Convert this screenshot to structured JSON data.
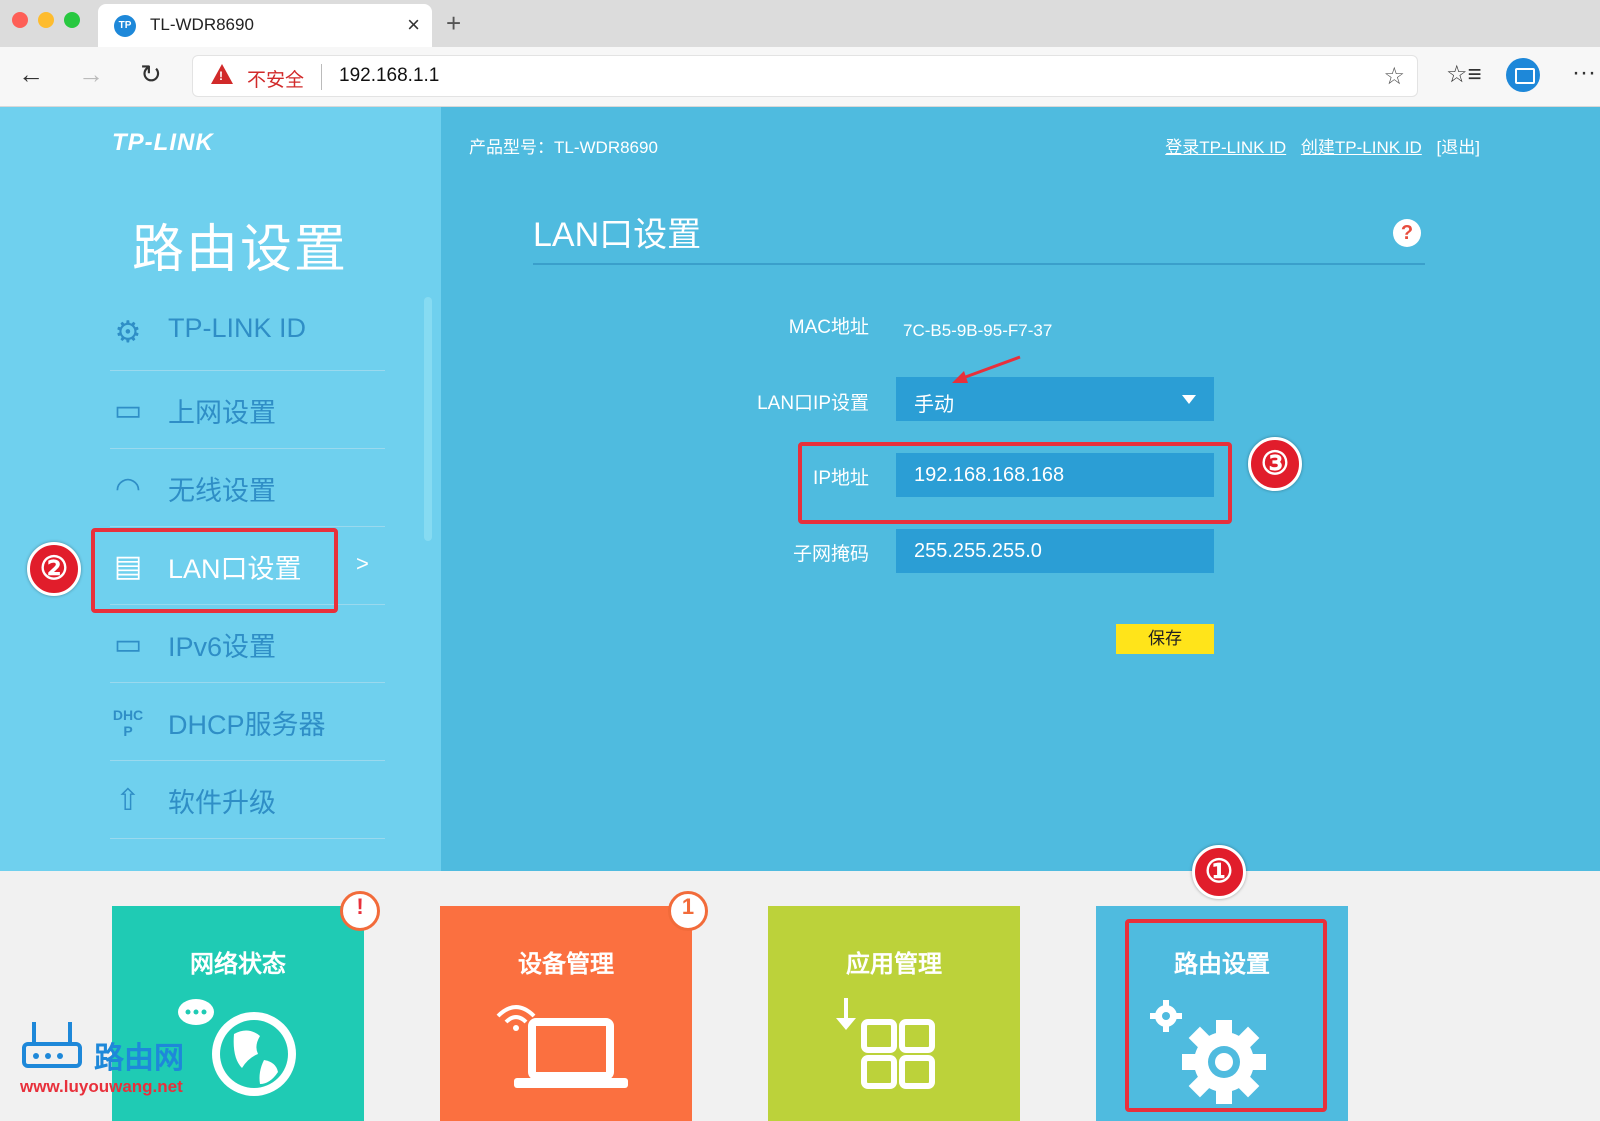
{
  "browser": {
    "tab_title": "TL-WDR8690",
    "tab_favicon": "TP",
    "tab_close": "×",
    "new_tab": "+",
    "back_icon": "←",
    "forward_icon": "→",
    "reload_icon": "↻",
    "insecure_label": "不安全",
    "url": "192.168.1.1",
    "star_icon": "☆",
    "favorites_icon": "☆≡",
    "more_icon": "···"
  },
  "router": {
    "logo": "TP-LINK",
    "model_line": "产品型号：TL-WDR8690",
    "links": {
      "login": "登录TP-LINK ID",
      "create": "创建TP-LINK ID",
      "logout": "[退出]"
    },
    "section_title": "路由设置",
    "menu": [
      {
        "label": "TP-LINK ID",
        "icon": "gear-icon",
        "glyph": "⚙"
      },
      {
        "label": "上网设置",
        "icon": "laptop-icon",
        "glyph": "▭"
      },
      {
        "label": "无线设置",
        "icon": "wifi-icon",
        "glyph": "◠"
      },
      {
        "label": "LAN口设置",
        "icon": "lan-port-icon",
        "glyph": "▤",
        "active": true,
        "arrow": ">"
      },
      {
        "label": "IPv6设置",
        "icon": "laptop-icon",
        "glyph": "▭"
      },
      {
        "label": "DHCP服务器",
        "icon": "dhcp-icon",
        "glyph": "DHCP"
      },
      {
        "label": "软件升级",
        "icon": "upload-icon",
        "glyph": "⇧"
      }
    ],
    "page_title": "LAN口设置",
    "help_icon": "?",
    "form": {
      "mac_label": "MAC地址",
      "mac_value": "7C-B5-9B-95-F7-37",
      "lan_ip_mode_label": "LAN口IP设置",
      "lan_ip_mode_value": "手动",
      "ip_label": "IP地址",
      "ip_value": "192.168.168.168",
      "mask_label": "子网掩码",
      "mask_value": "255.255.255.0",
      "save_label": "保存"
    },
    "tiles": [
      {
        "title": "网络状态",
        "color": "#1fcbb4",
        "badge": "!"
      },
      {
        "title": "设备管理",
        "color": "#fb7040",
        "badge": "1"
      },
      {
        "title": "应用管理",
        "color": "#bcd23a",
        "badge": ""
      },
      {
        "title": "路由设置",
        "color": "#4fbbdf",
        "badge": ""
      }
    ]
  },
  "annotations": {
    "callout_1": "①",
    "callout_2": "②",
    "callout_3": "③"
  },
  "watermark": {
    "brand": "路由网",
    "url": "www.luyouwang.net"
  },
  "colors": {
    "sidebar": "#6fd0ee",
    "content": "#4fbbdf",
    "field": "#2b9ed5",
    "save": "#ffe41a",
    "highlight": "#e8303b"
  }
}
